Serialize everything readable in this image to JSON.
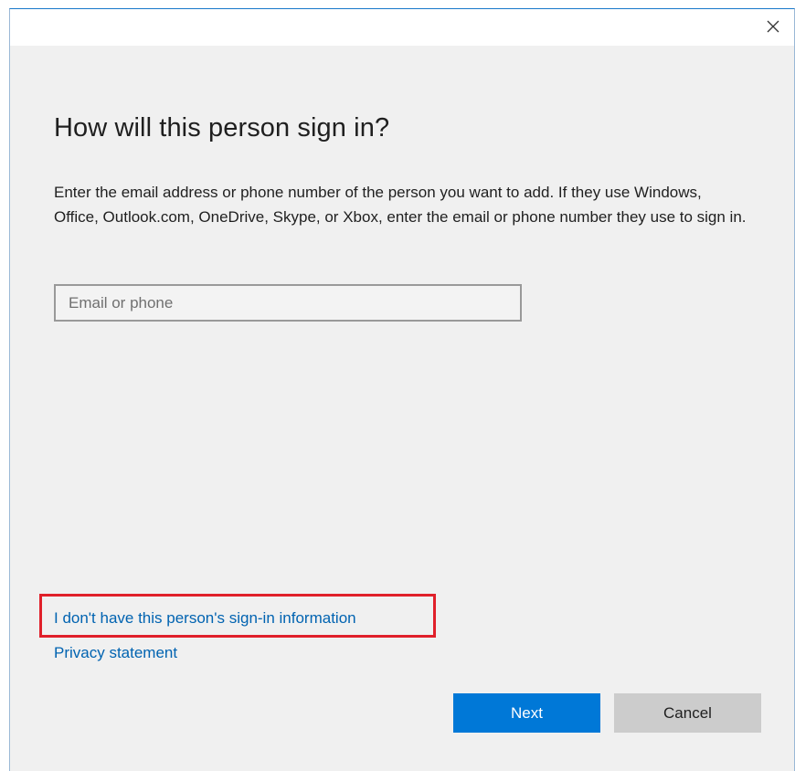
{
  "dialog": {
    "close_icon": "close-icon",
    "heading": "How will this person sign in?",
    "description": "Enter the email address or phone number of the person you want to add. If they use Windows, Office, Outlook.com, OneDrive, Skype, or Xbox, enter the email or phone number they use to sign in.",
    "email_input": {
      "value": "",
      "placeholder": "Email or phone"
    },
    "links": {
      "no_signin_info": "I don't have this person's sign-in information",
      "privacy": "Privacy statement"
    },
    "buttons": {
      "next": "Next",
      "cancel": "Cancel"
    },
    "colors": {
      "accent": "#0078d7",
      "link": "#0063b1",
      "highlight": "#e0202a",
      "background": "#f0f0f0"
    }
  }
}
